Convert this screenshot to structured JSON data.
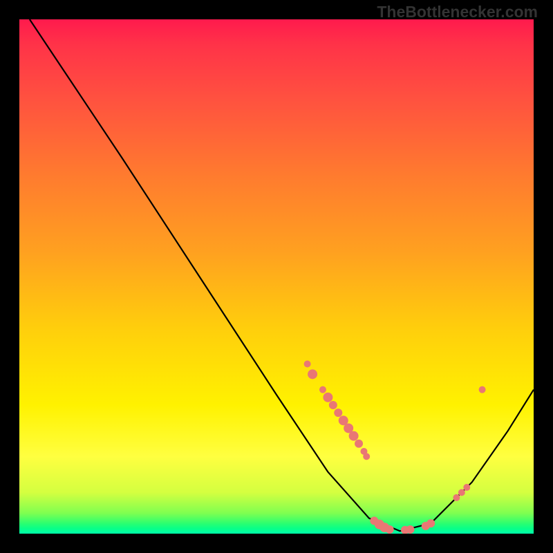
{
  "watermark": "TheBottlenecker.com",
  "chart_data": {
    "type": "line",
    "title": "",
    "xlabel": "",
    "ylabel": "",
    "xlim": [
      0,
      100
    ],
    "ylim": [
      0,
      100
    ],
    "curve": [
      {
        "x": 2,
        "y": 100
      },
      {
        "x": 8,
        "y": 91
      },
      {
        "x": 20,
        "y": 73
      },
      {
        "x": 35,
        "y": 50
      },
      {
        "x": 50,
        "y": 27
      },
      {
        "x": 60,
        "y": 12
      },
      {
        "x": 68,
        "y": 3
      },
      {
        "x": 74,
        "y": 0.5
      },
      {
        "x": 80,
        "y": 2
      },
      {
        "x": 88,
        "y": 10
      },
      {
        "x": 95,
        "y": 20
      },
      {
        "x": 100,
        "y": 28
      }
    ],
    "markers": [
      {
        "x": 56,
        "y": 33,
        "r": 5
      },
      {
        "x": 57,
        "y": 31,
        "r": 7
      },
      {
        "x": 59,
        "y": 28,
        "r": 5
      },
      {
        "x": 60,
        "y": 26.5,
        "r": 7
      },
      {
        "x": 61,
        "y": 25,
        "r": 6
      },
      {
        "x": 62,
        "y": 23.5,
        "r": 6
      },
      {
        "x": 63,
        "y": 22,
        "r": 7
      },
      {
        "x": 64,
        "y": 20.5,
        "r": 7
      },
      {
        "x": 65,
        "y": 19,
        "r": 7
      },
      {
        "x": 66,
        "y": 17.5,
        "r": 6
      },
      {
        "x": 67,
        "y": 16,
        "r": 5
      },
      {
        "x": 67.5,
        "y": 15,
        "r": 5
      },
      {
        "x": 69,
        "y": 2.5,
        "r": 6
      },
      {
        "x": 70,
        "y": 1.8,
        "r": 7
      },
      {
        "x": 71,
        "y": 1.2,
        "r": 7
      },
      {
        "x": 72,
        "y": 0.8,
        "r": 6
      },
      {
        "x": 75,
        "y": 0.7,
        "r": 6
      },
      {
        "x": 76,
        "y": 0.8,
        "r": 6
      },
      {
        "x": 79,
        "y": 1.5,
        "r": 6
      },
      {
        "x": 80,
        "y": 2,
        "r": 6
      },
      {
        "x": 85,
        "y": 7,
        "r": 5
      },
      {
        "x": 86,
        "y": 8,
        "r": 5
      },
      {
        "x": 87,
        "y": 9,
        "r": 5
      },
      {
        "x": 90,
        "y": 28,
        "r": 5
      }
    ],
    "gradient_stops": [
      {
        "offset": 0,
        "color": "#ff1a4d"
      },
      {
        "offset": 30,
        "color": "#ff7a2f"
      },
      {
        "offset": 60,
        "color": "#ffce0c"
      },
      {
        "offset": 85,
        "color": "#ffff40"
      },
      {
        "offset": 100,
        "color": "#00ffaa"
      }
    ]
  }
}
